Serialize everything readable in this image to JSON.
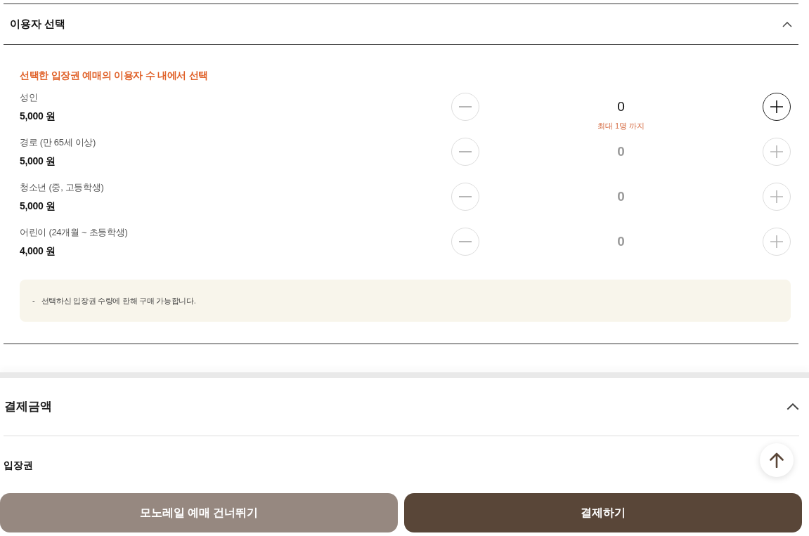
{
  "user_selection": {
    "title": "이용자 선택",
    "expanded": true,
    "notice": "선택한 입장권 예매의 이용자 수 내에서 선택",
    "rows": [
      {
        "label": "성인",
        "price": "5,000 원",
        "count": "0",
        "limit_note": "최대 1명 까지",
        "decrement_enabled": false,
        "increment_enabled": true
      },
      {
        "label": "경로 (만 65세 이상)",
        "price": "5,000 원",
        "count": "0",
        "decrement_enabled": false,
        "increment_enabled": false
      },
      {
        "label": "청소년 (중, 고등학생)",
        "price": "5,000 원",
        "count": "0",
        "decrement_enabled": false,
        "increment_enabled": false
      },
      {
        "label": "어린이 (24개월 ~ 초등학생)",
        "price": "4,000 원",
        "count": "0",
        "decrement_enabled": false,
        "increment_enabled": false
      }
    ],
    "notes": [
      {
        "marker": "-",
        "text": "선택하신 입장권 수량에 한해 구매 가능합니다."
      }
    ]
  },
  "payment_amount": {
    "title": "결제금액",
    "expanded": true,
    "items": [
      {
        "label": "입장권"
      }
    ]
  },
  "buttons": [
    {
      "label": "모노레일 예매 건너뛰기",
      "kind": "secondary"
    },
    {
      "label": "결제하기",
      "kind": "primary"
    }
  ]
}
